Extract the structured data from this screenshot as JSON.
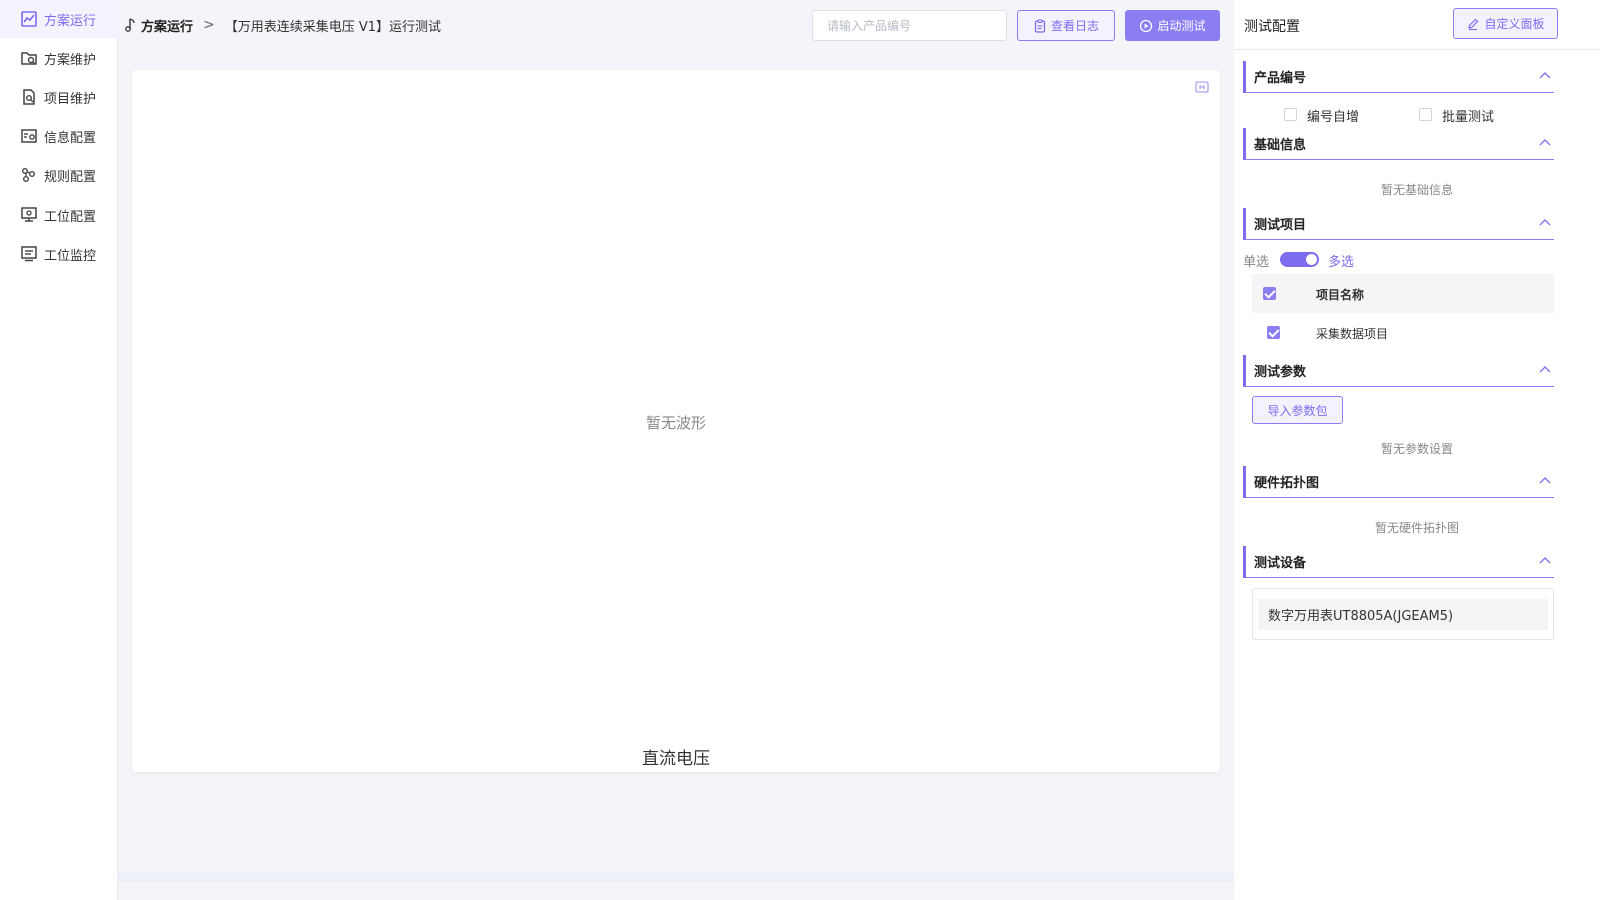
{
  "sidebar": {
    "items": [
      {
        "label": "方案运行",
        "icon": "chart-line-icon",
        "active": true
      },
      {
        "label": "方案维护",
        "icon": "folder-search-icon"
      },
      {
        "label": "项目维护",
        "icon": "document-search-icon"
      },
      {
        "label": "信息配置",
        "icon": "list-gear-icon"
      },
      {
        "label": "规则配置",
        "icon": "nodes-icon"
      },
      {
        "label": "工位配置",
        "icon": "monitor-gear-icon"
      },
      {
        "label": "工位监控",
        "icon": "monitor-list-icon"
      }
    ]
  },
  "header": {
    "breadcrumb_root": "方案运行",
    "breadcrumb_separator": ">",
    "breadcrumb_current": "【万用表连续采集电压 V1】运行测试",
    "search_placeholder": "请输入产品编号",
    "view_log_label": "查看日志",
    "start_test_label": "启动测试"
  },
  "main": {
    "empty_wave_text": "暂无波形",
    "chart_title": "直流电压"
  },
  "right_panel": {
    "title": "测试配置",
    "custom_panel_label": "自定义面板",
    "sections": {
      "product_number": {
        "title": "产品编号",
        "auto_increment_label": "编号自增",
        "auto_increment_checked": false,
        "batch_test_label": "批量测试",
        "batch_test_checked": false
      },
      "basic_info": {
        "title": "基础信息",
        "empty_text": "暂无基础信息"
      },
      "test_items": {
        "title": "测试项目",
        "single_label": "单选",
        "multi_label": "多选",
        "mode": "多选",
        "header_label": "项目名称",
        "items": [
          {
            "name": "采集数据项目",
            "checked": true
          }
        ]
      },
      "test_params": {
        "title": "测试参数",
        "import_label": "导入参数包",
        "empty_text": "暂无参数设置"
      },
      "hardware_topology": {
        "title": "硬件拓扑图",
        "empty_text": "暂无硬件拓扑图"
      },
      "test_devices": {
        "title": "测试设备",
        "devices": [
          "数字万用表UT8805A(JGEAM5)"
        ]
      }
    }
  },
  "colors": {
    "accent": "#7b6cf0",
    "accent_light": "#f4f2ff",
    "background": "#f4f5f9"
  }
}
